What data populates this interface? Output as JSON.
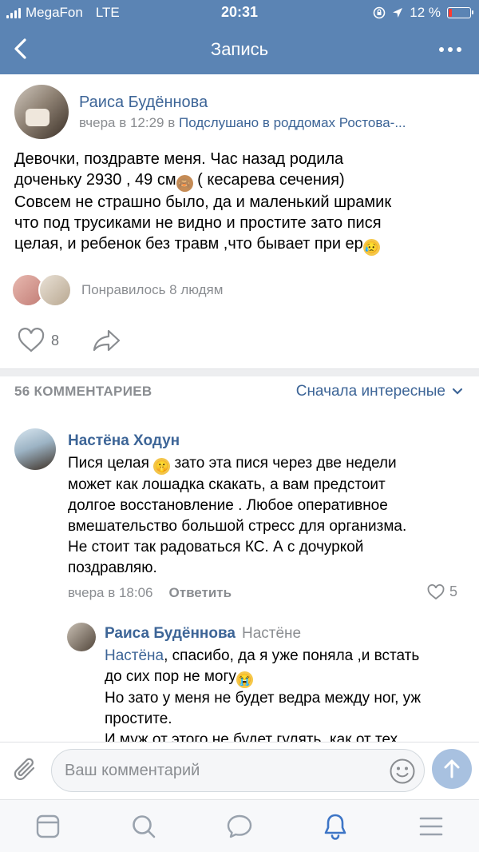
{
  "status_bar": {
    "carrier": "MegaFon",
    "network": "LTE",
    "time": "20:31",
    "battery": "12 %"
  },
  "nav": {
    "title": "Запись",
    "back_icon": "chevron-left-icon",
    "more_icon": "more-icon"
  },
  "post": {
    "author": "Раиса Будённова",
    "time": "вчера в 12:29",
    "in_word": "в",
    "group": "Подслушано в роддомах Ростова-...",
    "text": {
      "line1": "Девочки, поздравте меня. Час назад родила",
      "line2a": "доченьку 2930 , 49 см",
      "line2b": "  ( кесарева сечения)",
      "line3": "Совсем не страшно было, да и маленький шрамик",
      "line4": "что под трусиками не видно и простите зато пися",
      "line5": "целая, и ребенок без травм ,что бывает при ер"
    },
    "likes_text": "Понравилось 8 людям",
    "like_count": "8"
  },
  "comments_header": {
    "count_label": "56 КОММЕНТАРИЕВ",
    "sort_label": "Сначала интересные"
  },
  "comment": {
    "author": "Настёна Ходун",
    "text": {
      "line1a": "Пися целая",
      "line1b": " зато эта пися через две недели",
      "line2": "может как лошадка скакать, а вам предстоит",
      "line3": "долгое восстановление . Любое оперативное",
      "line4": "вмешательство большой стресс для организма.",
      "line5": "Не стоит так радоваться КС. А с дочуркой",
      "line6": "поздравляю."
    },
    "time": "вчера в 18:06",
    "reply_label": "Ответить",
    "like_count": "5"
  },
  "reply": {
    "author": "Раиса Будённова",
    "to": "Настёне",
    "mention": "Настёна",
    "text": {
      "line1b": ", спасибо, да я уже поняла ,и  встать",
      "line2": "до сих пор не могу",
      "line3": "Но зато у меня не будет ведра между ног, уж",
      "line4": "простите.",
      "line5": "И муж от этого не будет гулять, как от тех"
    }
  },
  "composer": {
    "placeholder": "Ваш комментарий"
  },
  "tabbar": {
    "items": [
      "news-feed-icon",
      "search-icon",
      "messages-icon",
      "notifications-icon",
      "menu-icon"
    ],
    "active": "notifications-icon"
  },
  "colors": {
    "header_bg": "#5b84b4",
    "link": "#3d6597",
    "muted": "#8a8d91",
    "active_tab": "#3d75c6"
  }
}
